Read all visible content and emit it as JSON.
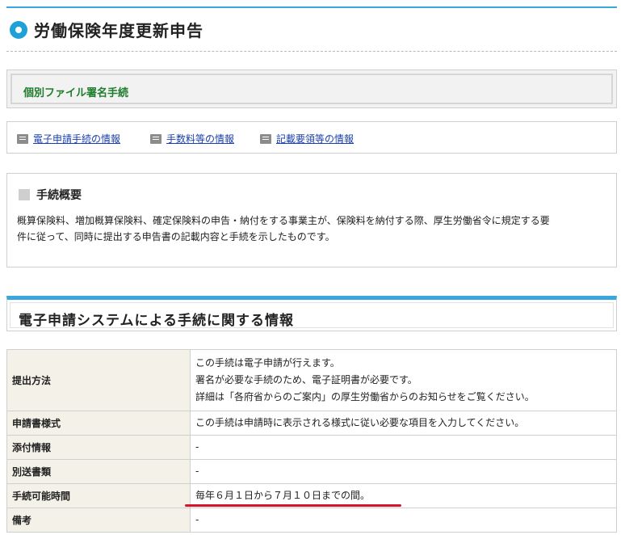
{
  "header": {
    "title": "労働保険年度更新申告",
    "icon": "bullet-circle-icon"
  },
  "section": {
    "label": "個別ファイル署名手続"
  },
  "links": [
    {
      "label": "電子申請手続の情報",
      "icon": "document-icon"
    },
    {
      "label": "手数料等の情報",
      "icon": "document-icon"
    },
    {
      "label": "記載要領等の情報",
      "icon": "document-icon"
    }
  ],
  "summary": {
    "title": "手続概要",
    "line1": "概算保険料、増加概算保険料、確定保険料の申告・納付をする事業主が、保険料を納付する際、厚生労働省令に規定する要",
    "line2": "件に従って、同時に提出する申告書の記載内容と手続を示したものです。"
  },
  "esys": {
    "title": "電子申請システムによる手続に関する情報"
  },
  "table": {
    "rows": [
      {
        "label": "提出方法",
        "lines": [
          "この手続は電子申請が行えます。",
          "署名が必要な手続のため、電子証明書が必要です。",
          "詳細は「各府省からのご案内」の厚生労働省からのお知らせをご覧ください。"
        ]
      },
      {
        "label": "申請書様式",
        "value": "この手続は申請時に表示される様式に従い必要な項目を入力してください。"
      },
      {
        "label": "添付情報",
        "value": "-"
      },
      {
        "label": "別送書類",
        "value": "-"
      },
      {
        "label": "手続可能時間",
        "value": "毎年６月１日から７月１０日までの間。"
      },
      {
        "label": "備考",
        "value": "-"
      }
    ]
  },
  "colors": {
    "accent": "#3aa6dc",
    "section_label": "#1e7d2c",
    "link": "#1a3fa8",
    "table_header_bg": "#f3f1e8",
    "annotation_underline": "#d8142a"
  }
}
